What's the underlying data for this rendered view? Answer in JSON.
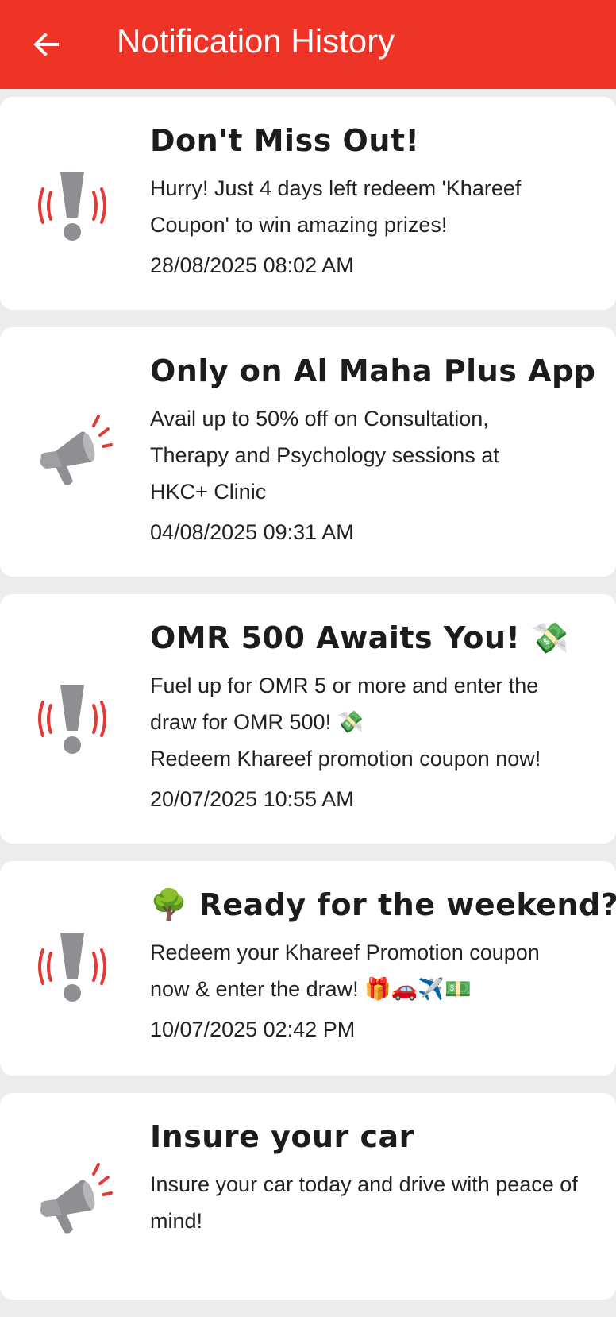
{
  "header": {
    "title": "Notification History",
    "back_icon": "arrow-left-icon",
    "background_color": "#ee3327"
  },
  "notifications": [
    {
      "icon": "alert-exclamation-icon",
      "title": "Don't Miss Out!",
      "body": "Hurry! Just 4 days left redeem 'Khareef Coupon' to win amazing prizes!",
      "date": "28/08/2025 08:02 AM"
    },
    {
      "icon": "megaphone-icon",
      "title": "Only on Al Maha Plus App",
      "body": "Avail up to 50% off on Consultation, Therapy and Psychology sessions at HKC+ Clinic",
      "date": "04/08/2025 09:31 AM"
    },
    {
      "icon": "alert-exclamation-icon",
      "title": "OMR 500 Awaits You! 💸",
      "body": "Fuel up for OMR 5 or more and enter the draw for OMR 500! 💸\nRedeem Khareef promotion coupon now!",
      "date": "20/07/2025 10:55 AM"
    },
    {
      "icon": "alert-exclamation-icon",
      "title": "🌳 Ready for the weekend?",
      "body": "Redeem your Khareef Promotion coupon now & enter the draw! 🎁🚗✈️💵",
      "date": "10/07/2025 02:42 PM"
    },
    {
      "icon": "megaphone-icon",
      "title": "Insure your car",
      "body": "Insure your car today and drive with peace of mind!",
      "date": ""
    }
  ],
  "colors": {
    "accent": "#ee3327",
    "icon_gray": "#8e8e93",
    "icon_red": "#e53935"
  }
}
